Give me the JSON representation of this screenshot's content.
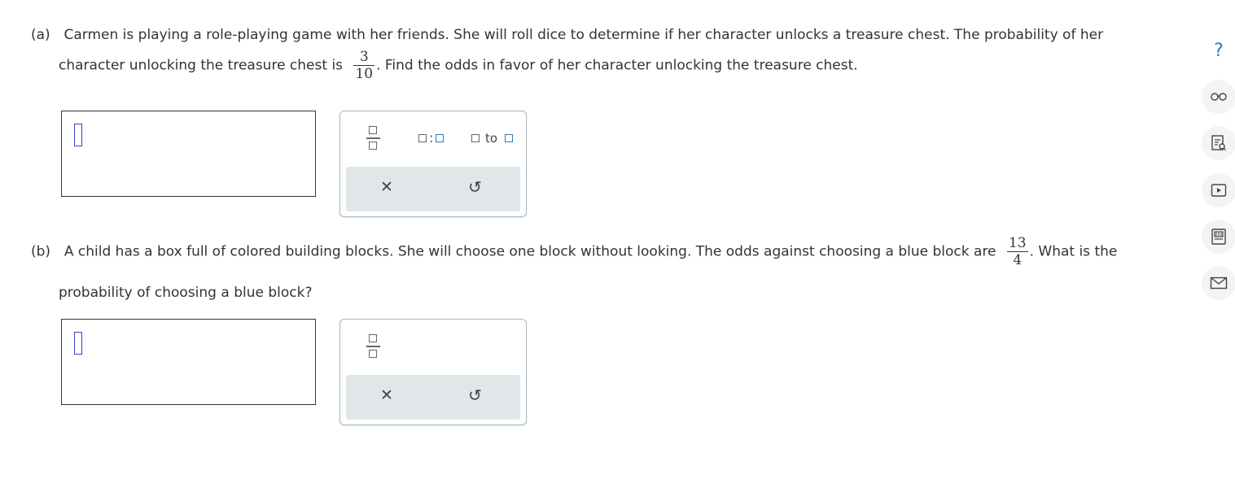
{
  "part_a": {
    "label": "(a)",
    "line1": "Carmen is playing a role-playing game with her friends. She will roll dice to determine if her character unlocks a treasure chest. The probability of her",
    "line2_before": "character unlocking the treasure chest is",
    "fraction": {
      "numerator": "3",
      "denominator": "10"
    },
    "line2_after": ". Find the odds in favor of her character unlocking the treasure chest."
  },
  "part_b": {
    "label": "(b)",
    "line1_before": "A child has a box full of colored building blocks. She will choose one block without looking. The odds against choosing a blue block are",
    "fraction": {
      "numerator": "13",
      "denominator": "4"
    },
    "line1_after": ". What is the",
    "line2": "probability of choosing a blue block?"
  },
  "palette_a": {
    "ratio_colon": ":",
    "to_word": "to",
    "clear_symbol": "✕",
    "undo_symbol": "↺"
  },
  "palette_b": {
    "clear_symbol": "✕",
    "undo_symbol": "↺"
  },
  "sidebar": {
    "help_symbol": "?"
  },
  "colors": {
    "cursor": "#3a3fc4",
    "accent_blue": "#2a7fb8",
    "palette_border": "#a7b7c2",
    "palette_bottom": "#e1e6e9"
  }
}
